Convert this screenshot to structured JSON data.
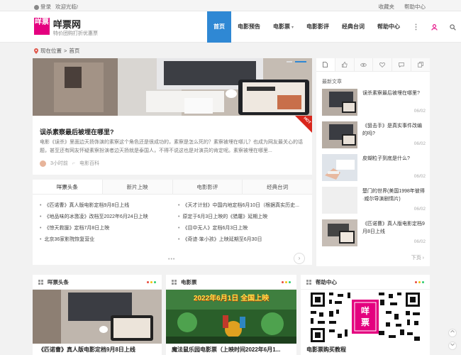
{
  "topbar": {
    "login": "登录",
    "welcome": "欢迎光临!",
    "favorites": "收藏夹",
    "help_center": "帮助中心"
  },
  "header": {
    "logo_text": "咩票",
    "site_name": "咩票网",
    "slogan": "特价团购打折优惠票",
    "nav": [
      {
        "label": "首页",
        "active": true
      },
      {
        "label": "电影预告"
      },
      {
        "label": "电影票"
      },
      {
        "label": "电影影评"
      },
      {
        "label": "经典台词"
      },
      {
        "label": "帮助中心"
      }
    ]
  },
  "breadcrumb": {
    "current_location": "现在位置",
    "separator": ">",
    "home": "首页"
  },
  "featured": {
    "badge": "HOT",
    "title": "误杀素察最后被埋在哪里?",
    "excerpt": "电影《误杀》里面边天扬饰演的素察这个角色还是很成功的，素察是怎么死的？素察被埋在哪儿？也成为网友最关心的话题，甚至还有网友怀疑素察扮演者边天扬就是泰国人，不得不说这也是对演员的肯定呢。素察被埋在哪里...",
    "time": "3小时前",
    "category": "电影百科"
  },
  "tabs": {
    "items": [
      {
        "label": "咩票头条",
        "active": true
      },
      {
        "label": "新片上映"
      },
      {
        "label": "电影影评"
      },
      {
        "label": "经典台词"
      }
    ],
    "articles_left": [
      "《匹诺曹》真人版电影定档9月8日上线",
      "《地品味的冰激凌》改档至2022年6月24日上映",
      "《惊天救援》定档7月8日上映",
      "北京36家影院恢复营业"
    ],
    "articles_right": [
      "《天才计划》中国内地定档6月10日（根据真实历史...",
      "原定于6月3日上映的《猎屠》延期上映",
      "《目中无人》定档6月3日上映",
      "《奇迹·笨小孩》上映延期至6月30日"
    ],
    "more": "•••",
    "next": "›"
  },
  "sidebar": {
    "title": "最新文章",
    "items": [
      {
        "title": "误杀素察最后被埋在哪里?",
        "date": "06/02"
      },
      {
        "title": "《狙击手》是真实事件改编的吗?",
        "date": "06/02"
      },
      {
        "title": "皮蝴粒子到底是什么?",
        "date": "06/02"
      },
      {
        "title": "楚门的世界(美国1998年彼得·威尔导演剧情片)",
        "date": "06/02"
      },
      {
        "title": "《匹诺曹》真人版电影定档9月8日上线",
        "date": "06/02"
      }
    ],
    "next": "下页 ›"
  },
  "bottom": [
    {
      "title": "咩票头条",
      "caption": "《匹诺曹》真人版电影定档9月8日上线"
    },
    {
      "title": "电影票",
      "caption": "魔法鼠乐园电影票（上映时间2022年6月1...",
      "banner": "2022年6月1日 全国上映"
    },
    {
      "title": "帮助中心",
      "caption": "电影票购买教程",
      "qr_logo": "咩票"
    }
  ],
  "colors": {
    "accent": "#2f88d4",
    "brand": "#e4007f",
    "hot": "#d9261c"
  }
}
